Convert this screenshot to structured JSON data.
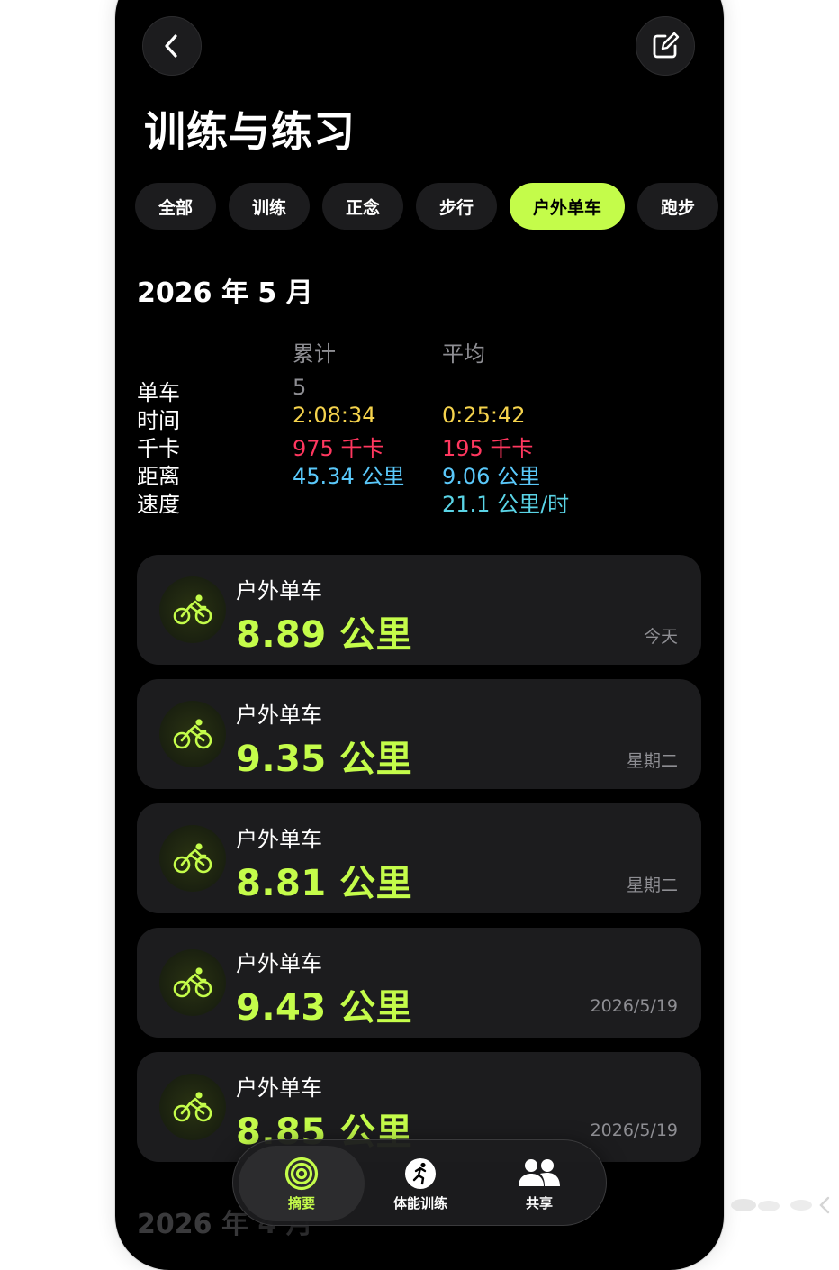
{
  "header": {
    "title": "训练与练习"
  },
  "filters": [
    {
      "label": "全部",
      "active": false
    },
    {
      "label": "训练",
      "active": false
    },
    {
      "label": "正念",
      "active": false
    },
    {
      "label": "步行",
      "active": false
    },
    {
      "label": "户外单车",
      "active": true
    },
    {
      "label": "跑步",
      "active": false
    }
  ],
  "summary": {
    "month": "2026 年 5 月",
    "col_total": "累计",
    "col_avg": "平均",
    "rows": [
      {
        "label": "单车",
        "total": "5",
        "avg": ""
      },
      {
        "label": "时间",
        "total": "2:08:34",
        "avg": "0:25:42"
      },
      {
        "label": "千卡",
        "total": "975 千卡",
        "avg": "195 千卡"
      },
      {
        "label": "距离",
        "total": "45.34 公里",
        "avg": "9.06 公里"
      },
      {
        "label": "速度",
        "total": "",
        "avg": "21.1 公里/时"
      }
    ],
    "colors": {
      "count": "#8e8e93",
      "time": "#f5d34d",
      "calories": "#ff375f",
      "distance": "#5ac8fa",
      "speed": "#5ad4e6"
    }
  },
  "workouts": [
    {
      "type": "户外单车",
      "distance": "8.89 公里",
      "date": "今天",
      "icon": "cycling-icon"
    },
    {
      "type": "户外单车",
      "distance": "9.35 公里",
      "date": "星期二",
      "icon": "cycling-icon"
    },
    {
      "type": "户外单车",
      "distance": "8.81 公里",
      "date": "星期二",
      "icon": "cycling-icon"
    },
    {
      "type": "户外单车",
      "distance": "9.43 公里",
      "date": "2026/5/19",
      "icon": "cycling-icon"
    },
    {
      "type": "户外单车",
      "distance": "8.85 公里",
      "date": "2026/5/19",
      "icon": "cycling-icon"
    }
  ],
  "next_section": {
    "month": "2026 年 4 月"
  },
  "tabbar": {
    "tabs": [
      {
        "label": "摘要",
        "icon": "activity-rings-icon",
        "active": true
      },
      {
        "label": "体能训练",
        "icon": "fitness-icon",
        "active": false
      },
      {
        "label": "共享",
        "icon": "sharing-icon",
        "active": false
      }
    ]
  },
  "accent_color": "#c4fc4a"
}
